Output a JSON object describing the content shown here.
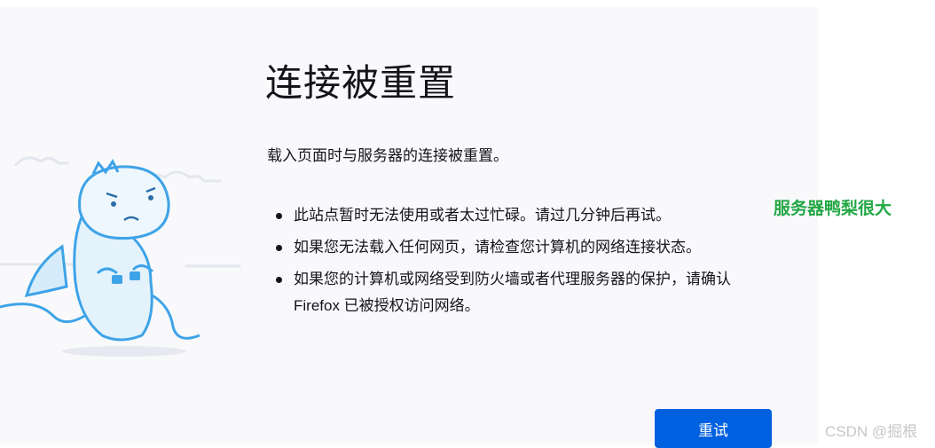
{
  "error_page": {
    "title": "连接被重置",
    "intro": "载入页面时与服务器的连接被重置。",
    "reasons": [
      "此站点暂时无法使用或者太过忙碌。请过几分钟后再试。",
      "如果您无法载入任何网页，请检查您计算机的网络连接状态。",
      "如果您的计算机或网络受到防火墙或者代理服务器的保护，请确认 Firefox 已被授权访问网络。"
    ],
    "retry_label": "重试",
    "illustration_icon": "dino-unplugged-icon"
  },
  "annotation": {
    "note": "服务器鸭梨很大",
    "color": "#22a744"
  },
  "watermark": "CSDN @掘根",
  "colors": {
    "panel_bg": "#f9f9fb",
    "button_bg": "#0061e0",
    "illustration_stroke": "#3ea3e8",
    "illustration_fill": "#d6ecfb"
  }
}
